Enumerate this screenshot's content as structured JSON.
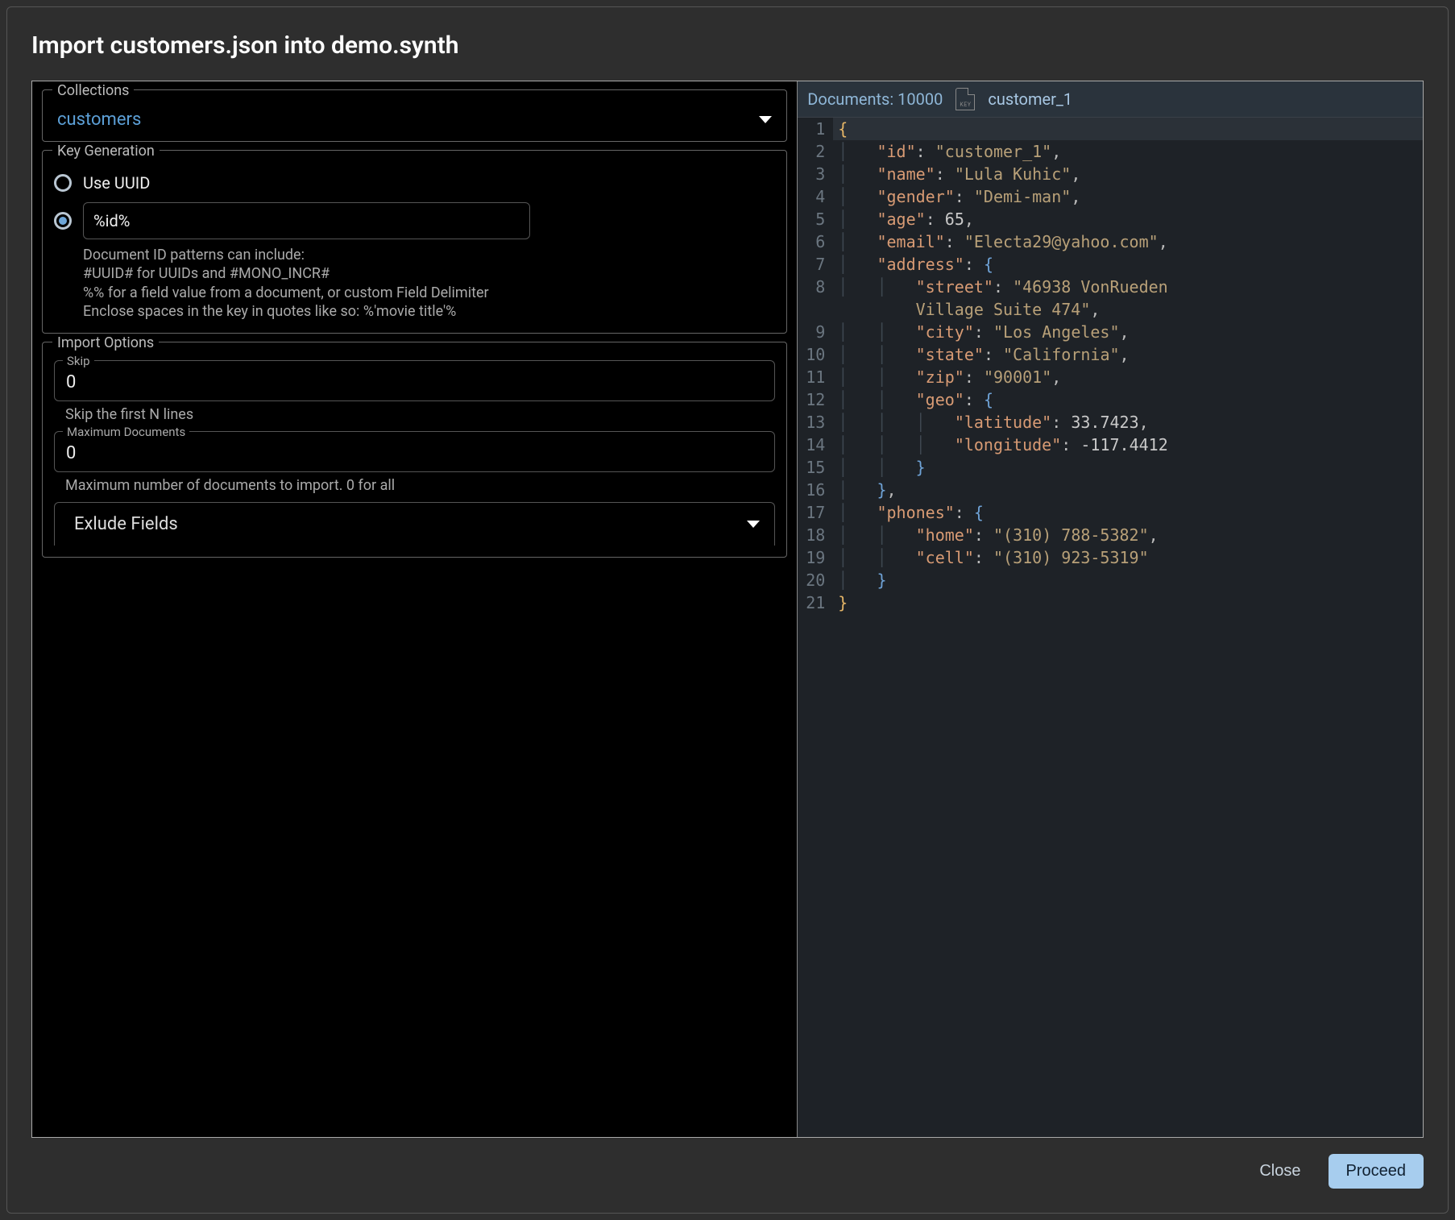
{
  "title": "Import customers.json into demo.synth",
  "collections": {
    "label": "Collections",
    "value": "customers"
  },
  "keygen": {
    "legend": "Key Generation",
    "uuid_label": "Use UUID",
    "pattern_value": "%id%",
    "help1": "Document ID patterns can include:",
    "help2": "#UUID# for UUIDs and #MONO_INCR#",
    "help3": "%% for a field value from a document, or custom Field Delimiter",
    "help4": "Enclose spaces in the key in quotes like so: %'movie title'%"
  },
  "import_options": {
    "legend": "Import Options",
    "skip_label": "Skip",
    "skip_value": "0",
    "skip_help": "Skip the first N lines",
    "max_label": "Maximum Documents",
    "max_value": "0",
    "max_help": "Maximum number of documents to import. 0 for all",
    "exclude_label": "Exlude Fields"
  },
  "preview": {
    "doc_count_label": "Documents: 10000",
    "key_badge": "KEY",
    "doc_key": "customer_1",
    "json": {
      "id": "customer_1",
      "name": "Lula Kuhic",
      "gender": "Demi-man",
      "age": 65,
      "email": "Electa29@yahoo.com",
      "address": {
        "street": "46938 VonRueden Village Suite 474",
        "city": "Los Angeles",
        "state": "California",
        "zip": "90001",
        "geo": {
          "latitude": 33.7423,
          "longitude": -117.4412
        }
      },
      "phones": {
        "home": "(310) 788-5382",
        "cell": "(310) 923-5319"
      }
    }
  },
  "buttons": {
    "close": "Close",
    "proceed": "Proceed"
  }
}
